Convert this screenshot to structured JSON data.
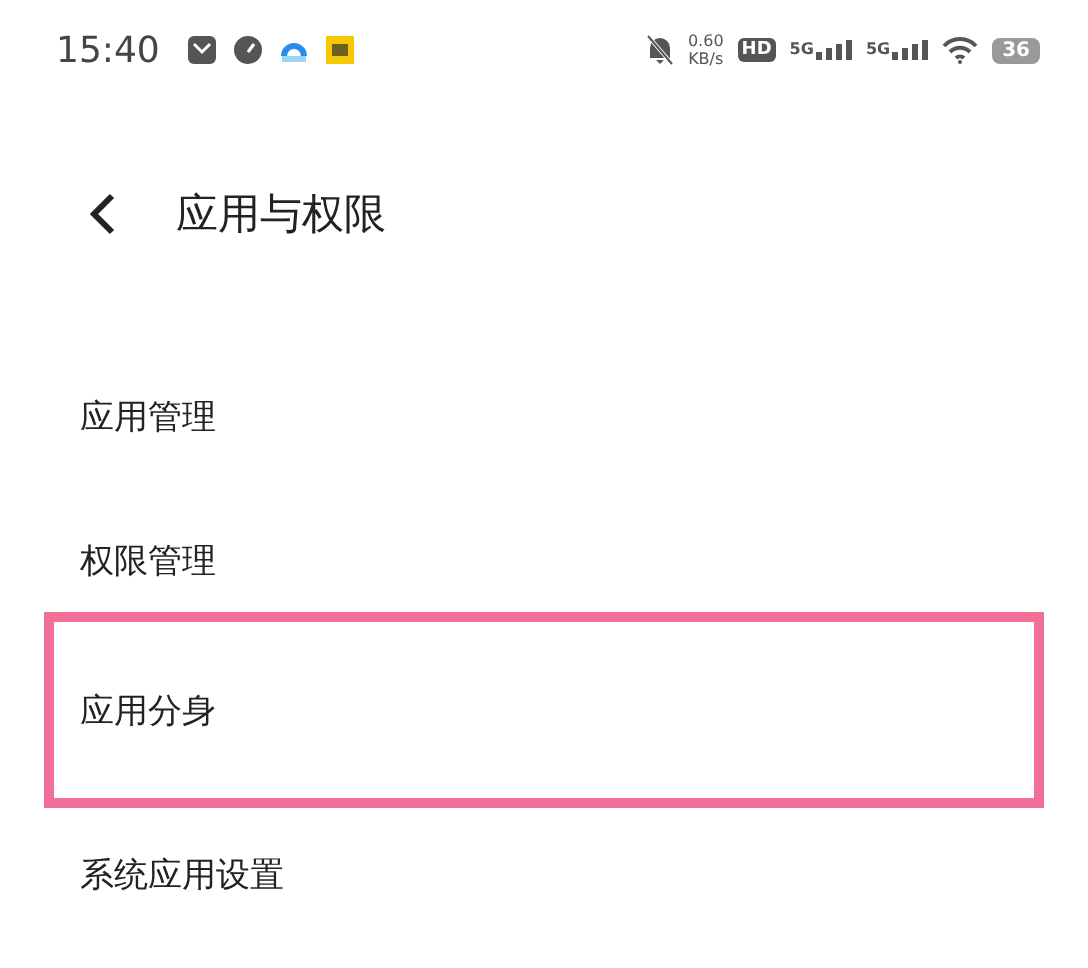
{
  "status_bar": {
    "time": "15:40",
    "speed_value": "0.60",
    "speed_unit": "KB/s",
    "hd": "HD",
    "signals": [
      "5G",
      "5G"
    ],
    "battery": "36"
  },
  "header": {
    "title": "应用与权限"
  },
  "items": [
    {
      "label": "应用管理",
      "highlighted": false
    },
    {
      "label": "权限管理",
      "highlighted": false
    },
    {
      "label": "应用分身",
      "highlighted": true
    },
    {
      "label": "系统应用设置",
      "highlighted": false
    }
  ]
}
